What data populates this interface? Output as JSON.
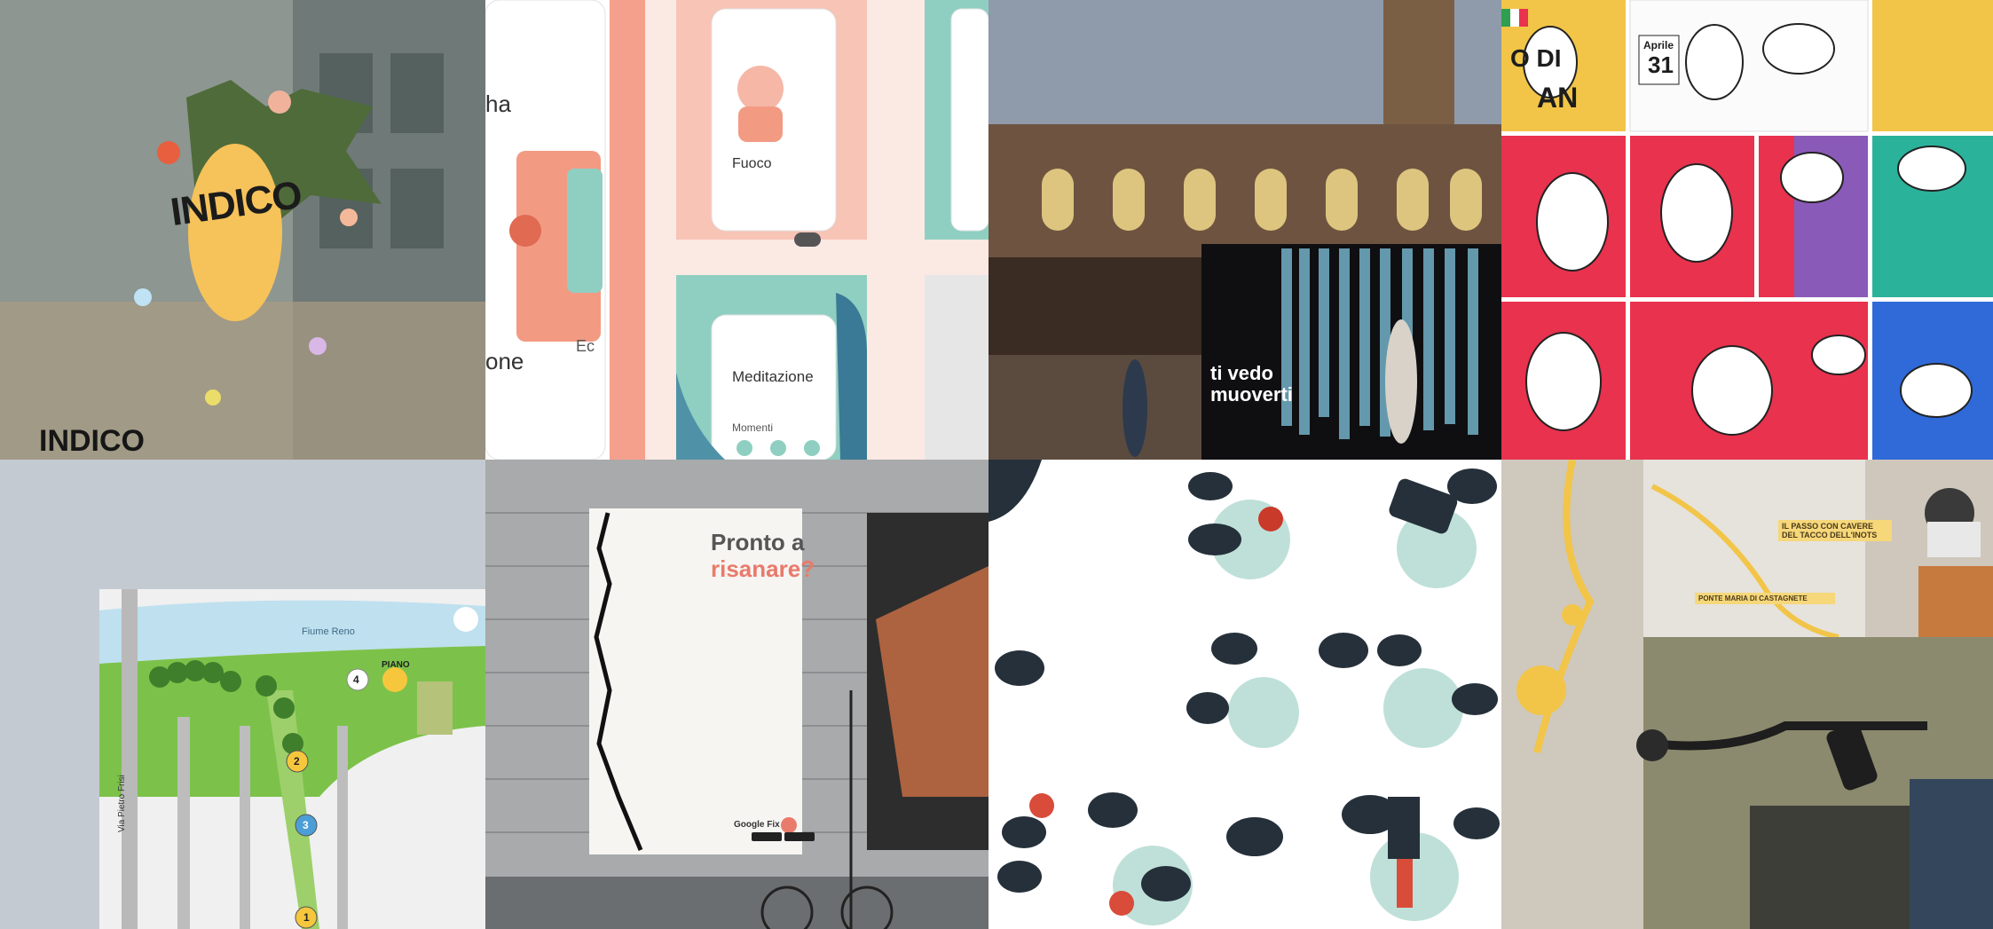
{
  "tiles": {
    "indico": {
      "sign_text": "INDICO",
      "footer_text": "INDICO"
    },
    "app": {
      "screen1_title": "ha",
      "screen1_caption": "one",
      "screen2_title": "Fuoco",
      "screen3_title": "Meditazione",
      "screen3_sub": "Momenti",
      "peek_label": "Ec"
    },
    "bologna": {
      "installation_text_line1": "ti vedo",
      "installation_text_line2": "muoverti"
    },
    "comic": {
      "visible_fragment": "O DI",
      "visible_fragment2": "AN",
      "date_top": "Aprile",
      "date_num": "31"
    },
    "map": {
      "river_label": "Fiume Reno",
      "street_label": "Via Pietro Frisi",
      "pin_label": "PIANO",
      "numbers": [
        "1",
        "2",
        "3",
        "4"
      ]
    },
    "poster": {
      "headline_line1": "Pronto",
      "headline_line1b": "a",
      "headline_line2": "risanare?",
      "brand": "Google Fix"
    },
    "illustration": {},
    "route": {
      "card_text1": "IL PASSO CON CAVERE DEL TACCO DELL'INOTS",
      "card_text2": "PONTE MARIA DI CASTAGNETE"
    }
  },
  "colors": {
    "indico_yellow": "#f6c25a",
    "app_pink": "#f29f8c",
    "app_teal": "#8fcfc1",
    "comic_red": "#e8324e",
    "map_green": "#7cc24a",
    "poster_accent": "#e87b6b",
    "bubble_dark": "#25303a"
  }
}
